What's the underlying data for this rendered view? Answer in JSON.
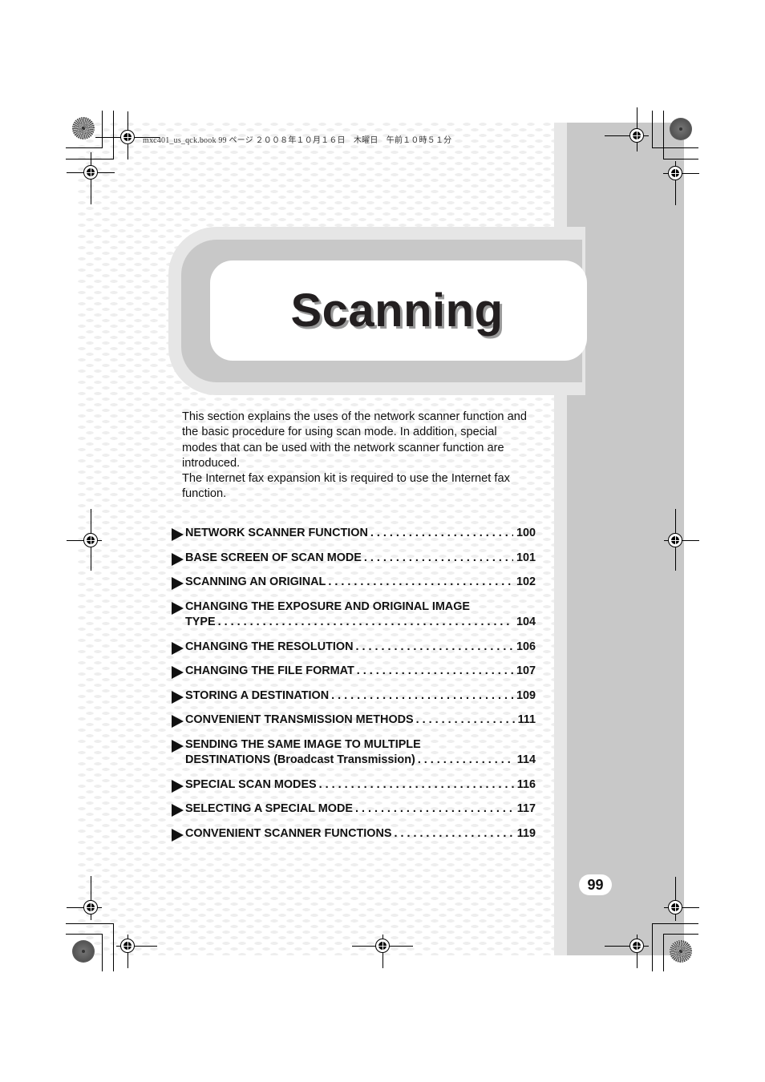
{
  "print_header": "mxc401_us_qck.book  99 ページ  ２００８年１０月１６日　木曜日　午前１０時５１分",
  "chapter": {
    "title": "Scanning"
  },
  "intro": {
    "paragraphs": [
      "This section explains the uses of the network scanner function and the basic procedure for using scan mode. In addition, special modes that can be used with the network scanner function are introduced.",
      "The Internet fax expansion kit is required to use the Internet fax function."
    ]
  },
  "toc": [
    {
      "label": "NETWORK SCANNER FUNCTION",
      "page": "100"
    },
    {
      "label": "BASE SCREEN OF SCAN MODE",
      "page": "101"
    },
    {
      "label": "SCANNING AN ORIGINAL",
      "page": "102"
    },
    {
      "label_line1": "CHANGING THE EXPOSURE AND ORIGINAL IMAGE",
      "label": "TYPE",
      "page": "104"
    },
    {
      "label": "CHANGING THE RESOLUTION",
      "page": "106"
    },
    {
      "label": "CHANGING THE FILE FORMAT",
      "page": "107"
    },
    {
      "label": "STORING A DESTINATION",
      "page": "109"
    },
    {
      "label": "CONVENIENT TRANSMISSION METHODS",
      "page": "111"
    },
    {
      "label_line1": "SENDING THE SAME IMAGE TO MULTIPLE",
      "label": "DESTINATIONS (Broadcast Transmission)",
      "page": "114"
    },
    {
      "label": "SPECIAL SCAN MODES",
      "page": "116"
    },
    {
      "label": "SELECTING A SPECIAL MODE",
      "page": "117"
    },
    {
      "label": "CONVENIENT SCANNER FUNCTIONS",
      "page": "119"
    }
  ],
  "page_number": "99",
  "colors": {
    "side_dark": "#c8c8c8",
    "side_light": "#e6e6e6",
    "text": "#111111"
  }
}
